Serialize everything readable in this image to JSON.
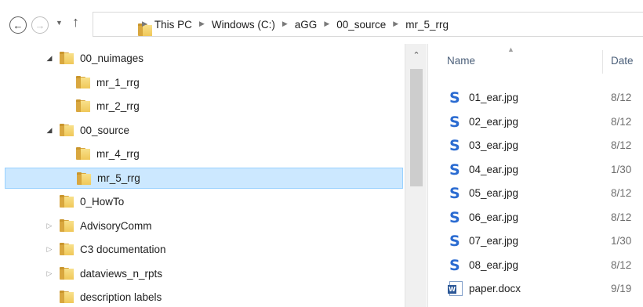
{
  "breadcrumb": [
    "This PC",
    "Windows (C:)",
    "aGG",
    "00_source",
    "mr_5_rrg"
  ],
  "tree": [
    {
      "label": "00_nuimages",
      "expander": "expanded",
      "indent": 1
    },
    {
      "label": "mr_1_rrg",
      "expander": "none",
      "indent": 2
    },
    {
      "label": "mr_2_rrg",
      "expander": "none",
      "indent": 2
    },
    {
      "label": "00_source",
      "expander": "expanded",
      "indent": 1
    },
    {
      "label": "mr_4_rrg",
      "expander": "none",
      "indent": 2
    },
    {
      "label": "mr_5_rrg",
      "expander": "none",
      "indent": 2,
      "selected": true
    },
    {
      "label": "0_HowTo",
      "expander": "none",
      "indent": 1
    },
    {
      "label": "AdvisoryComm",
      "expander": "collapsed",
      "indent": 1
    },
    {
      "label": "C3 documentation",
      "expander": "collapsed",
      "indent": 1
    },
    {
      "label": "dataviews_n_rpts",
      "expander": "collapsed",
      "indent": 1
    },
    {
      "label": "description labels",
      "expander": "none",
      "indent": 1
    }
  ],
  "columns": {
    "name": "Name",
    "date": "Date"
  },
  "files": [
    {
      "name": "01_ear.jpg",
      "date": "8/12",
      "icon": "s-icon"
    },
    {
      "name": "02_ear.jpg",
      "date": "8/12",
      "icon": "s-icon"
    },
    {
      "name": "03_ear.jpg",
      "date": "8/12",
      "icon": "s-icon"
    },
    {
      "name": "04_ear.jpg",
      "date": "1/30",
      "icon": "s-icon"
    },
    {
      "name": "05_ear.jpg",
      "date": "8/12",
      "icon": "s-icon"
    },
    {
      "name": "06_ear.jpg",
      "date": "8/12",
      "icon": "s-icon"
    },
    {
      "name": "07_ear.jpg",
      "date": "1/30",
      "icon": "s-icon"
    },
    {
      "name": "08_ear.jpg",
      "date": "8/12",
      "icon": "s-icon"
    },
    {
      "name": "paper.docx",
      "date": "9/19",
      "icon": "word-doc-icon"
    }
  ],
  "colors": {
    "selection": "#cce8ff",
    "selection_border": "#99d1ff",
    "header_text": "#4c607a",
    "folder": "#f0c859"
  }
}
